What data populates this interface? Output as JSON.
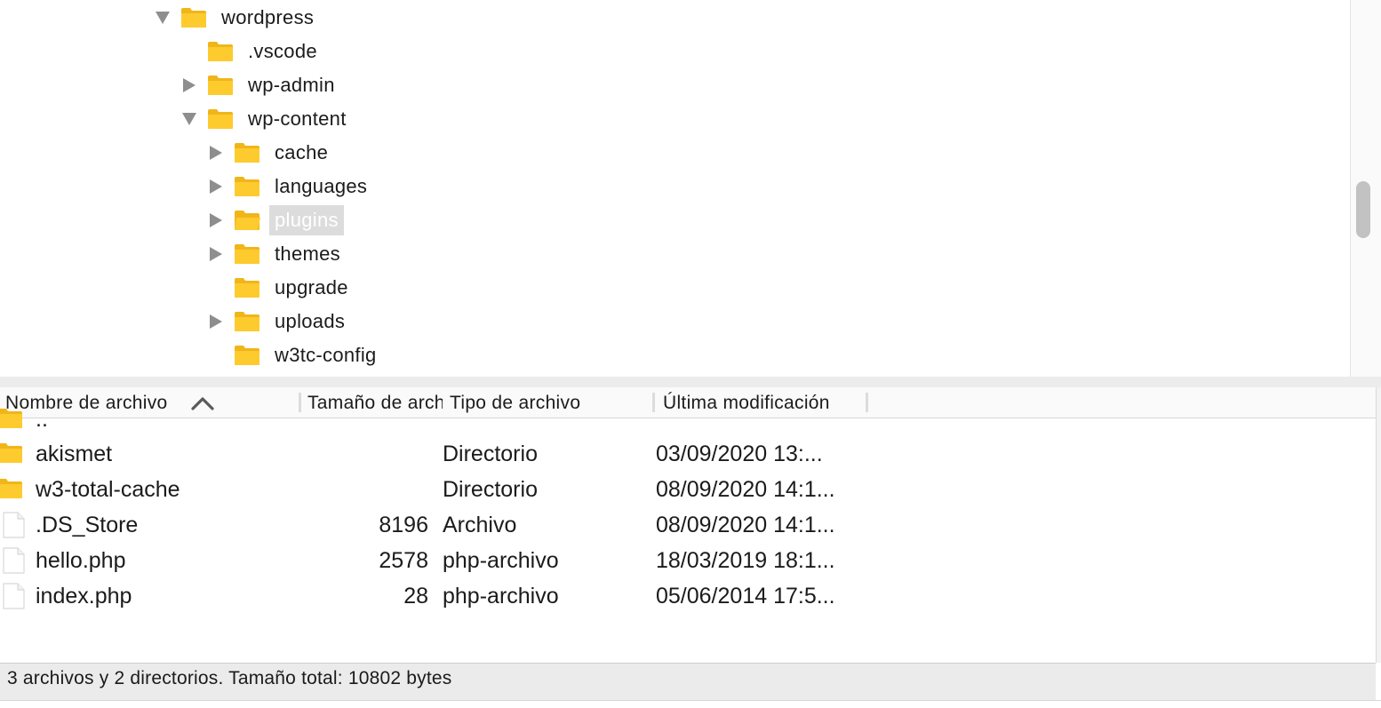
{
  "colors": {
    "folder": "#fdcb2e",
    "folder_dark": "#f0b518",
    "selection": "#dcdcdc",
    "status_bg": "#ebebeb"
  },
  "tree": {
    "items": [
      {
        "label": "wordpress",
        "toggle": "expanded",
        "icon": "folder-icon",
        "selected": false
      },
      {
        "label": ".vscode",
        "toggle": "none",
        "icon": "folder-icon",
        "selected": false
      },
      {
        "label": "wp-admin",
        "toggle": "collapsed",
        "icon": "folder-icon",
        "selected": false
      },
      {
        "label": "wp-content",
        "toggle": "expanded",
        "icon": "folder-icon",
        "selected": false
      },
      {
        "label": "cache",
        "toggle": "collapsed",
        "icon": "folder-icon",
        "selected": false
      },
      {
        "label": "languages",
        "toggle": "collapsed",
        "icon": "folder-icon",
        "selected": false
      },
      {
        "label": "plugins",
        "toggle": "collapsed",
        "icon": "folder-open-icon",
        "selected": true
      },
      {
        "label": "themes",
        "toggle": "collapsed",
        "icon": "folder-icon",
        "selected": false
      },
      {
        "label": "upgrade",
        "toggle": "none",
        "icon": "folder-icon",
        "selected": false
      },
      {
        "label": "uploads",
        "toggle": "collapsed",
        "icon": "folder-icon",
        "selected": false
      },
      {
        "label": "w3tc-config",
        "toggle": "none",
        "icon": "folder-icon",
        "selected": false
      }
    ]
  },
  "file_list": {
    "columns": {
      "name": "Nombre de archivo",
      "size": "Tamaño de archivo",
      "type": "Tipo de archivo",
      "modified": "Última modificación"
    },
    "sort_icon": "chevron-up-icon",
    "rows": [
      {
        "name": "..",
        "size": "",
        "type": "",
        "modified": "",
        "icon": "folder-icon"
      },
      {
        "name": "akismet",
        "size": "",
        "type": "Directorio",
        "modified": "03/09/2020 13:...",
        "icon": "folder-icon"
      },
      {
        "name": "w3-total-cache",
        "size": "",
        "type": "Directorio",
        "modified": "08/09/2020 14:1...",
        "icon": "folder-icon"
      },
      {
        "name": ".DS_Store",
        "size": "8196",
        "type": "Archivo",
        "modified": "08/09/2020 14:1...",
        "icon": "file-icon"
      },
      {
        "name": "hello.php",
        "size": "2578",
        "type": "php-archivo",
        "modified": "18/03/2019 18:1...",
        "icon": "file-icon"
      },
      {
        "name": "index.php",
        "size": "28",
        "type": "php-archivo",
        "modified": "05/06/2014 17:5...",
        "icon": "file-icon"
      }
    ]
  },
  "status": {
    "text": "3 archivos y 2 directorios. Tamaño total: 10802 bytes"
  }
}
